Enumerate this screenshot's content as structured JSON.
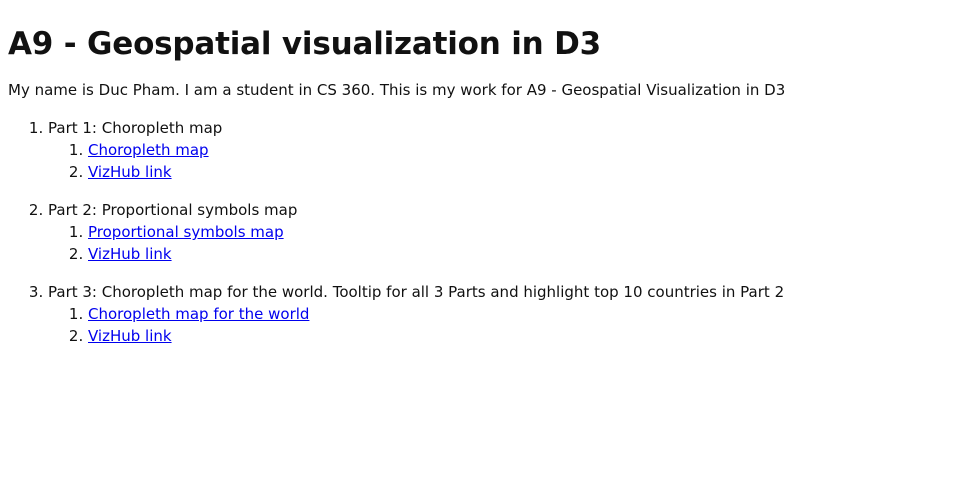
{
  "heading": "A9 - Geospatial visualization in D3",
  "intro": "My name is Duc Pham. I am a student in CS 360. This is my work for A9 - Geospatial Visualization in D3",
  "parts": [
    {
      "title": "Part 1: Choropleth map",
      "links": [
        {
          "label": "Choropleth map"
        },
        {
          "label": "VizHub link"
        }
      ]
    },
    {
      "title": "Part 2: Proportional symbols map",
      "links": [
        {
          "label": "Proportional symbols map"
        },
        {
          "label": "VizHub link"
        }
      ]
    },
    {
      "title": "Part 3: Choropleth map for the world. Tooltip for all 3 Parts and highlight top 10 countries in Part 2",
      "links": [
        {
          "label": "Choropleth map for the world"
        },
        {
          "label": "VizHub link"
        }
      ]
    }
  ],
  "colors": {
    "link": "#0000ee",
    "text": "#111111",
    "background": "#ffffff"
  }
}
